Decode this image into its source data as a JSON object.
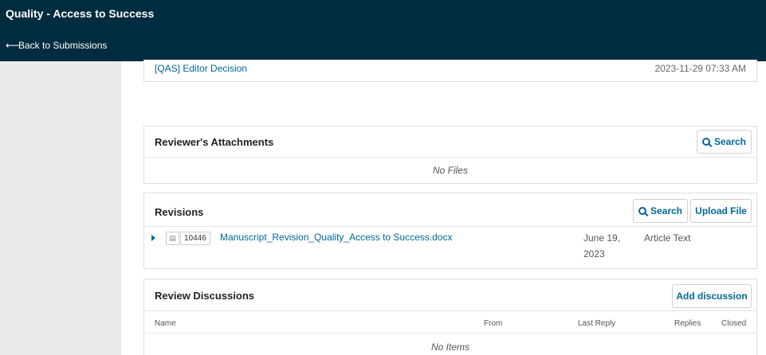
{
  "header": {
    "title": "Quality - Access to Success",
    "back_link": "Back to Submissions"
  },
  "email_row": {
    "subject": "[QAS] Editor Decision",
    "date": "2023-11-29 07:33 AM"
  },
  "attachments": {
    "title": "Reviewer's Attachments",
    "search_label": "Search",
    "empty_text": "No Files"
  },
  "revisions": {
    "title": "Revisions",
    "search_label": "Search",
    "upload_label": "Upload File",
    "file": {
      "id": "10446",
      "name": "Manuscript_Revision_Quality_Access to Success.docx",
      "date_line1": "June 19,",
      "date_line2": "2023",
      "type": "Article Text"
    }
  },
  "discussions": {
    "title": "Review Discussions",
    "add_label": "Add discussion",
    "columns": [
      "Name",
      "From",
      "Last Reply",
      "Replies",
      "Closed"
    ],
    "empty_text": "No Items"
  },
  "colors": {
    "header_bg": "#002c40",
    "link": "#006798",
    "sidebar_bg": "#e9ebeb"
  }
}
